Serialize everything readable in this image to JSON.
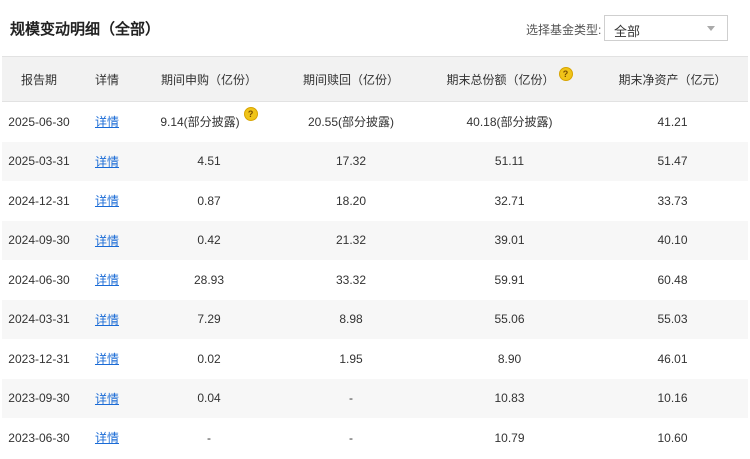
{
  "title": "规模变动明细（全部）",
  "filter": {
    "label": "选择基金类型:",
    "selected": "全部"
  },
  "columns": {
    "date": "报告期",
    "detail": "详情",
    "subscribe": "期间申购（亿份）",
    "redeem": "期间赎回（亿份）",
    "total": "期末总份额（亿份）",
    "nav": "期末净资产（亿元）"
  },
  "rows": [
    {
      "date": "2025-06-30",
      "detail": "详情",
      "subscribe": "9.14(部分披露)",
      "subscribe_help": true,
      "redeem": "20.55(部分披露)",
      "total": "40.18(部分披露)",
      "nav": "41.21"
    },
    {
      "date": "2025-03-31",
      "detail": "详情",
      "subscribe": "4.51",
      "subscribe_help": false,
      "redeem": "17.32",
      "total": "51.11",
      "nav": "51.47"
    },
    {
      "date": "2024-12-31",
      "detail": "详情",
      "subscribe": "0.87",
      "subscribe_help": false,
      "redeem": "18.20",
      "total": "32.71",
      "nav": "33.73"
    },
    {
      "date": "2024-09-30",
      "detail": "详情",
      "subscribe": "0.42",
      "subscribe_help": false,
      "redeem": "21.32",
      "total": "39.01",
      "nav": "40.10"
    },
    {
      "date": "2024-06-30",
      "detail": "详情",
      "subscribe": "28.93",
      "subscribe_help": false,
      "redeem": "33.32",
      "total": "59.91",
      "nav": "60.48"
    },
    {
      "date": "2024-03-31",
      "detail": "详情",
      "subscribe": "7.29",
      "subscribe_help": false,
      "redeem": "8.98",
      "total": "55.06",
      "nav": "55.03"
    },
    {
      "date": "2023-12-31",
      "detail": "详情",
      "subscribe": "0.02",
      "subscribe_help": false,
      "redeem": "1.95",
      "total": "8.90",
      "nav": "46.01"
    },
    {
      "date": "2023-09-30",
      "detail": "详情",
      "subscribe": "0.04",
      "subscribe_help": false,
      "redeem": "-",
      "total": "10.83",
      "nav": "10.16"
    },
    {
      "date": "2023-06-30",
      "detail": "详情",
      "subscribe": "-",
      "subscribe_help": false,
      "redeem": "-",
      "total": "10.79",
      "nav": "10.60"
    }
  ],
  "help_glyph": "?",
  "colors": {
    "link": "#1a6bd6",
    "header_bg": "#f2f2f2",
    "stripe": "#f7f7f7",
    "help_icon": "#f0c419"
  }
}
